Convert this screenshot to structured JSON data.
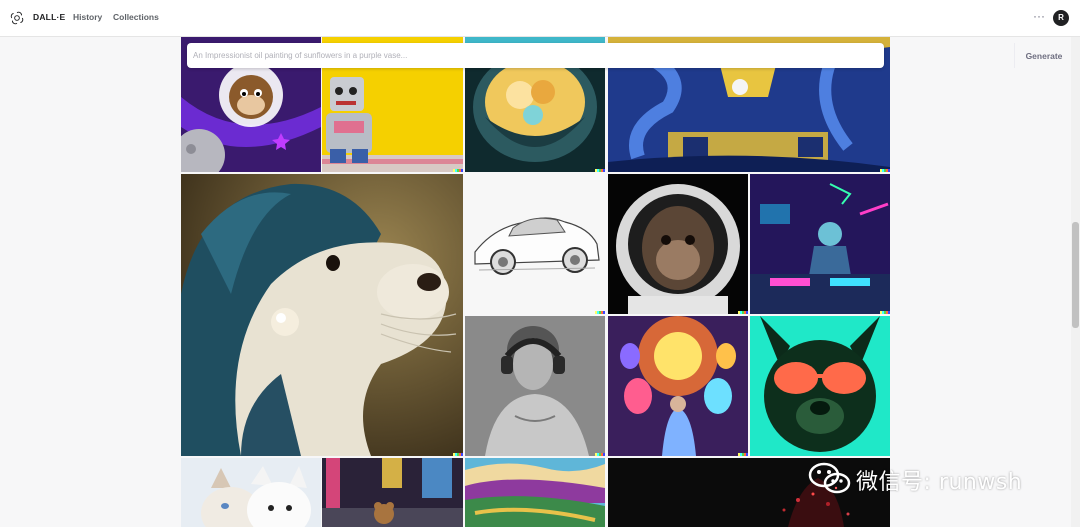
{
  "header": {
    "brand": "DALL·E",
    "nav": [
      {
        "label": "History"
      },
      {
        "label": "Collections"
      }
    ],
    "more_label": "···",
    "avatar_initial": "R"
  },
  "prompt": {
    "placeholder": "An Impressionist oil painting of sunflowers in a purple vase...",
    "value": "",
    "button_label": "Generate"
  },
  "gallery": {
    "images": [
      {
        "subject": "cartoon monkey astronaut in space"
      },
      {
        "subject": "toy robot sitting against yellow wall"
      },
      {
        "subject": "bowl with glowing golden clouds"
      },
      {
        "subject": "blue and yellow textured painting"
      },
      {
        "subject": "sea otter with hood and pearl earring"
      },
      {
        "subject": "pencil sketch of sports car"
      },
      {
        "subject": "monkey in astronaut helmet"
      },
      {
        "subject": "cyberpunk DJ in neon room"
      },
      {
        "subject": "marble statue wearing headphones"
      },
      {
        "subject": "psychedelic painting of light bulbs"
      },
      {
        "subject": "neon pop art bulldog with sunglasses"
      },
      {
        "subject": "white cat and puppy"
      },
      {
        "subject": "teddy bear in city street at night"
      },
      {
        "subject": "colorful impasto landscape painting"
      },
      {
        "subject": "dark artwork with red particles"
      }
    ]
  },
  "watermark": {
    "text": "微信号: runwsh"
  },
  "colors": {
    "accent": "#202123",
    "page_background": "#f7f7f8"
  }
}
